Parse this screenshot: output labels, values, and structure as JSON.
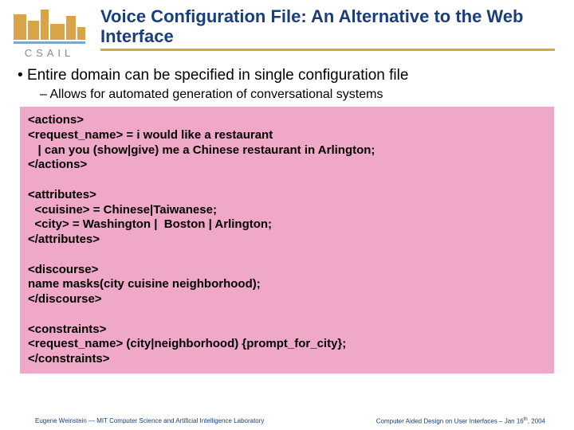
{
  "logo": {
    "text": "CSAIL"
  },
  "title": "Voice Configuration File: An Alternative to the Web Interface",
  "bullets": {
    "b1": "Entire domain can be specified in single configuration file",
    "b2": "Allows for automated generation of conversational systems"
  },
  "code": "<actions>\n<request_name> = i would like a restaurant\n   | can you (show|give) me a Chinese restaurant in Arlington;\n</actions>\n\n<attributes>\n  <cuisine> = Chinese|Taiwanese;\n  <city> = Washington |  Boston | Arlington;\n</attributes>\n\n<discourse>\nname masks(city cuisine neighborhood);\n</discourse>\n\n<constraints>\n<request_name> (city|neighborhood) {prompt_for_city};\n</constraints>",
  "footer": {
    "left": "Eugene Weinstein — MIT Computer Science and Artificial Intelligence Laboratory",
    "right_pre": "Computer Aided Design on User Interfaces – Jan 16",
    "right_sup": "th",
    "right_post": ", 2004"
  }
}
